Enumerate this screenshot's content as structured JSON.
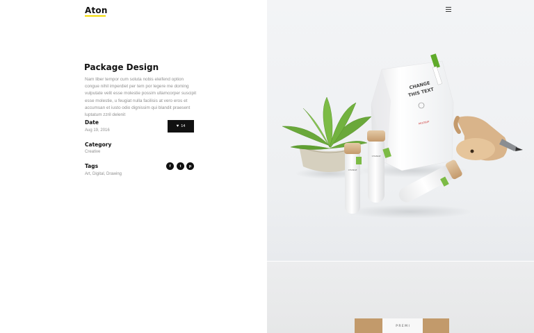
{
  "brand": {
    "logo_text": "Aton",
    "accent_color": "#f2d900"
  },
  "project": {
    "title": "Package Design",
    "description": "Nam liber tempor cum soluta nobis eleifend option congue nihil imperdiet per tem por legere me doming vulputate velit esse molestie possim ullamcorper suscipit esse molestie, u feugiat nulla facilisis at vero eros et accumsan et iusto odio dignissim qui blandit praesent luptatum zzril delenit"
  },
  "meta": {
    "date_label": "Date",
    "date_value": "Aug 19, 2016",
    "category_label": "Category",
    "category_value": "Creative",
    "tags_label": "Tags",
    "tags_value": "Art, Digital, Drawing"
  },
  "like": {
    "icon": "heart-icon",
    "count": "14"
  },
  "share": [
    {
      "icon": "facebook-icon",
      "glyph": "f"
    },
    {
      "icon": "twitter-icon",
      "glyph": "t"
    },
    {
      "icon": "pinterest-icon",
      "glyph": "p"
    }
  ],
  "header": {
    "menu_icon": "hamburger-menu-icon"
  },
  "mockup": {
    "bag_label": "CHANGE THIS TEXT",
    "bag_sub": "MOCKUP",
    "tube_label": "CHANGE THIS TEXT",
    "box_label": "PREMIUM"
  }
}
